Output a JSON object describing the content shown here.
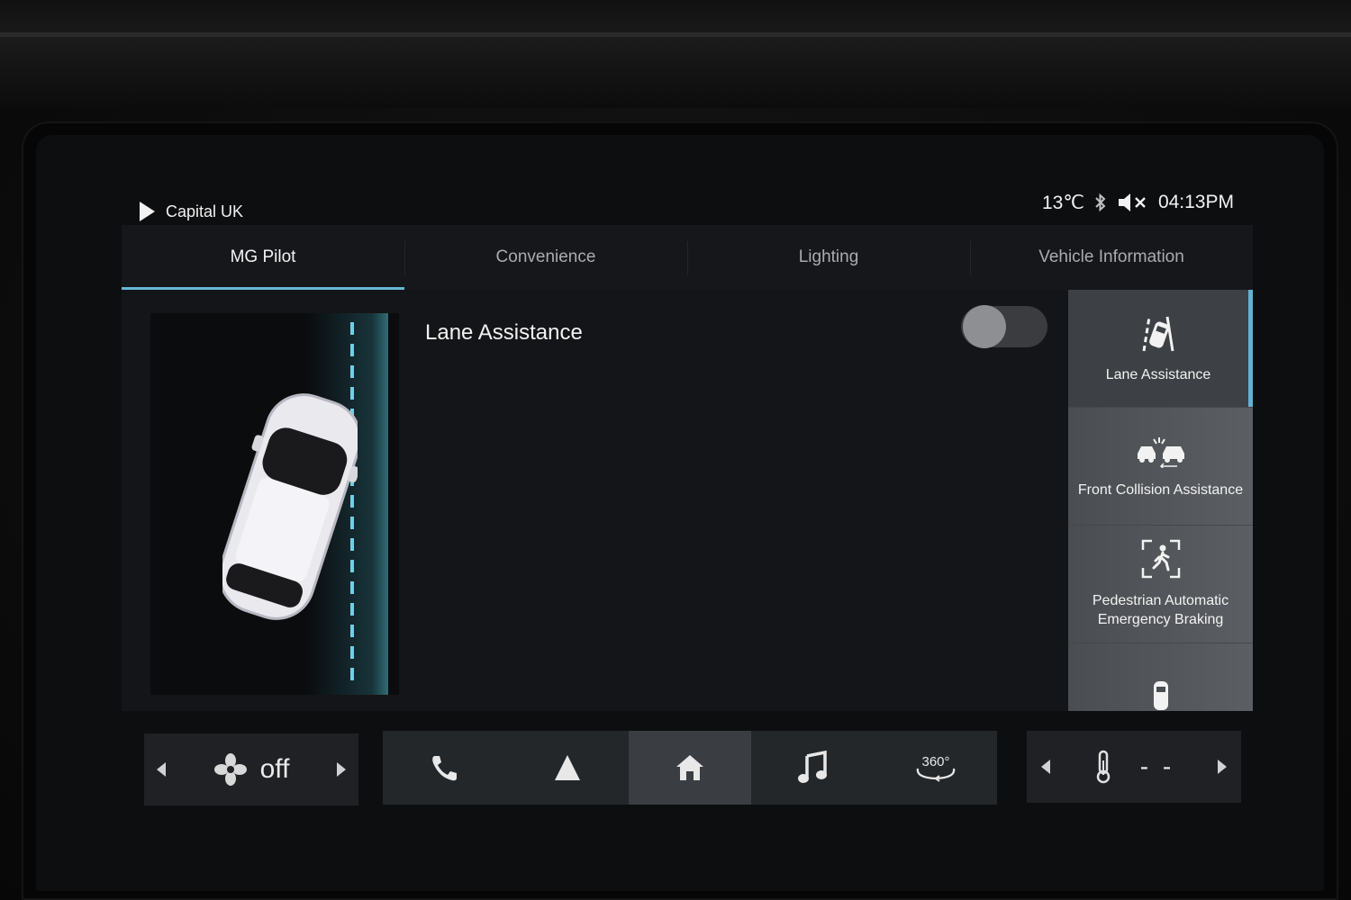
{
  "status": {
    "station": "Capital UK",
    "temperature": "13℃",
    "time": "04:13PM"
  },
  "tabs": [
    {
      "label": "MG Pilot",
      "active": true
    },
    {
      "label": "Convenience"
    },
    {
      "label": "Lighting"
    },
    {
      "label": "Vehicle Information"
    }
  ],
  "main": {
    "feature_title": "Lane Assistance",
    "toggle_on": false
  },
  "side": {
    "items": [
      {
        "label": "Lane Assistance",
        "icon": "lane-assist-icon",
        "active": true
      },
      {
        "label": "Front Collision Assistance",
        "icon": "front-collision-icon"
      },
      {
        "label": "Pedestrian Automatic Emergency Braking",
        "icon": "pedestrian-braking-icon"
      },
      {
        "label": "",
        "icon": "rear-sensor-icon"
      }
    ]
  },
  "dock": {
    "fan_state": "off",
    "temp_value": "- -",
    "buttons": [
      "phone-icon",
      "navigation-icon",
      "home-icon",
      "music-icon",
      "camera-360-icon"
    ],
    "camera_label": "360°"
  },
  "colors": {
    "accent": "#67b7d6",
    "background": "#0d0e10"
  }
}
